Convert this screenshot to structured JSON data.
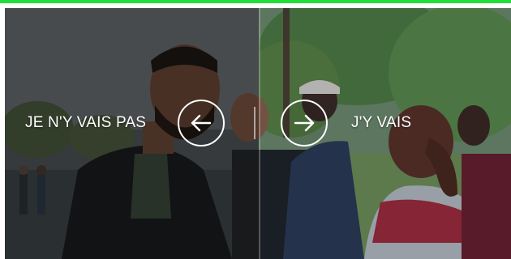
{
  "choices": {
    "left_label": "JE N'Y VAIS PAS",
    "right_label": "J'Y VAIS"
  },
  "icons": {
    "left_button": "arrow-left-icon",
    "right_button": "arrow-right-icon"
  },
  "colors": {
    "accent_top_bar": "#22e03a",
    "button_outline": "#ffffff",
    "label_text": "#ffffff"
  }
}
